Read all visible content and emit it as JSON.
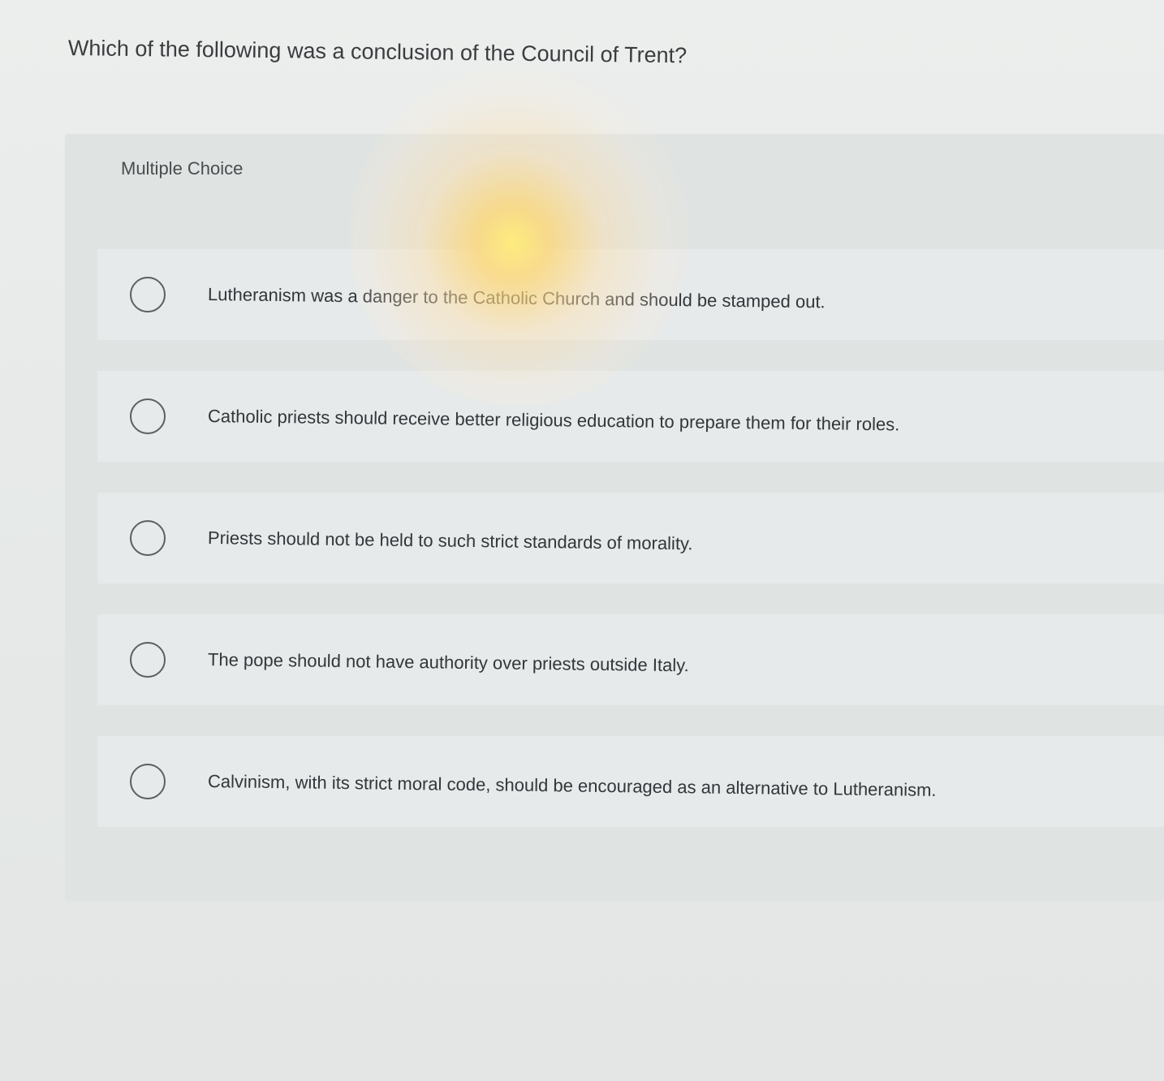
{
  "question": {
    "text": "Which of the following was a conclusion of the Council of Trent?"
  },
  "multiple_choice": {
    "label": "Multiple Choice",
    "options": [
      {
        "label": "Lutheranism was a danger to the Catholic Church and should be stamped out."
      },
      {
        "label": "Catholic priests should receive better religious education to prepare them for their roles."
      },
      {
        "label": "Priests should not be held to such strict standards of morality."
      },
      {
        "label": "The pope should not have authority over priests outside Italy."
      },
      {
        "label": "Calvinism, with its strict moral code, should be encouraged as an alternative to Lutheranism."
      }
    ]
  }
}
